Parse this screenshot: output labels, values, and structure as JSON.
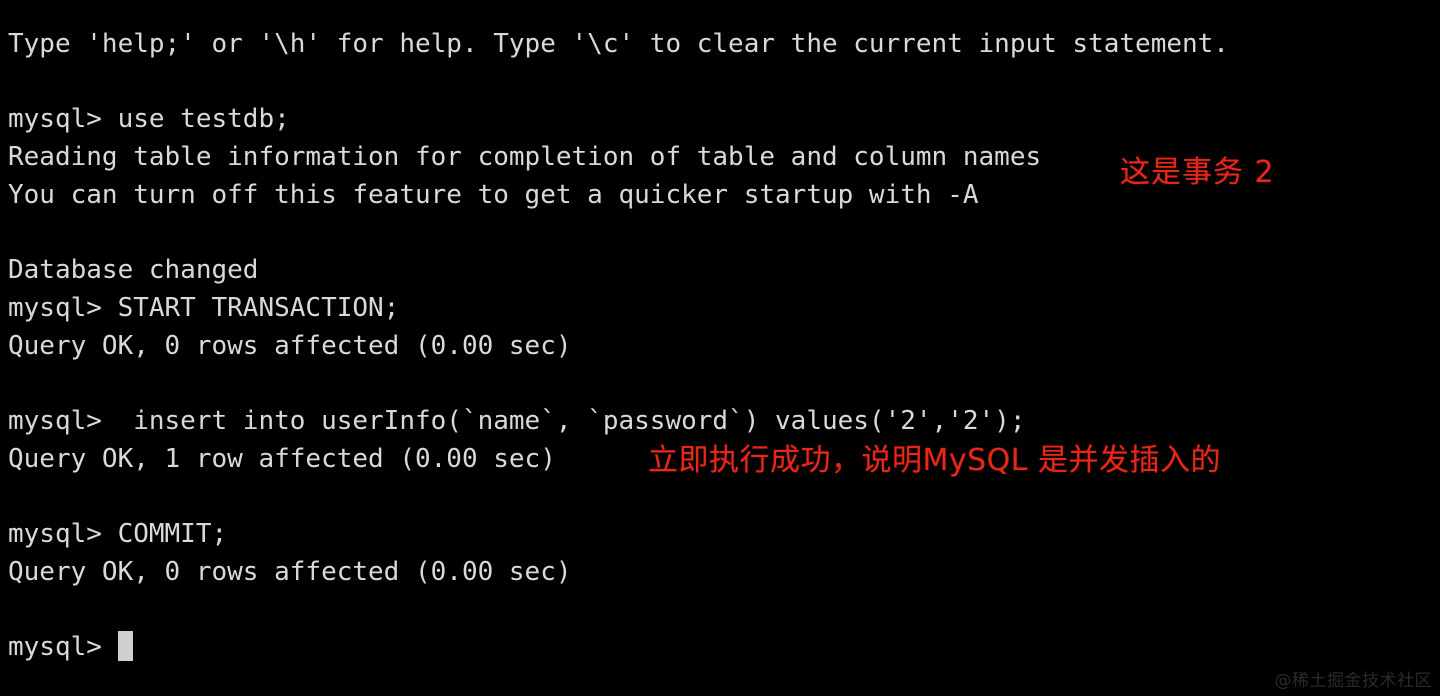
{
  "terminal": {
    "background_color": "#000000",
    "text_color": "#d9d9d9",
    "cursor_color": "#cfcfcf",
    "lines": [
      "Type 'help;' or '\\h' for help. Type '\\c' to clear the current input statement.",
      "",
      "mysql> use testdb;",
      "Reading table information for completion of table and column names",
      "You can turn off this feature to get a quicker startup with -A",
      "",
      "Database changed",
      "mysql> START TRANSACTION;",
      "Query OK, 0 rows affected (0.00 sec)",
      "",
      "mysql>  insert into userInfo(`name`, `password`) values('2','2');",
      "Query OK, 1 row affected (0.00 sec)",
      "",
      "mysql> COMMIT;",
      "Query OK, 0 rows affected (0.00 sec)",
      "",
      "mysql> "
    ],
    "prompt_last": "mysql> "
  },
  "annotations": {
    "color": "#e72718",
    "transaction_label": "这是事务 2",
    "concurrent_insert_label": "立即执行成功，说明MySQL 是并发插入的"
  },
  "watermark": {
    "text": "@稀土掘金技术社区",
    "color": "#2a2a2a"
  }
}
